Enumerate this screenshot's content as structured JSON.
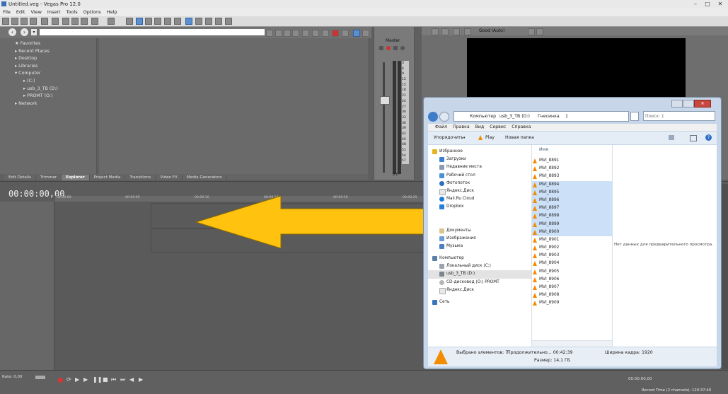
{
  "app": {
    "title": "Untitled.veg - Vegas Pro 12.0",
    "window_controls": [
      "–",
      "□",
      "✕"
    ]
  },
  "menu": [
    "File",
    "Edit",
    "View",
    "Insert",
    "Tools",
    "Options",
    "Help"
  ],
  "explorer_tree": {
    "items": [
      "Favorites",
      "Recent Places",
      "Desktop",
      "Libraries",
      "Computer",
      "(C:)",
      "usb_3_TB (D:)",
      "PROMT (O:)",
      "Network"
    ]
  },
  "tabs": [
    "Edit Details",
    "Trimmer",
    "Explorer",
    "Project Media",
    "Transitions",
    "Video FX",
    "Media Generators"
  ],
  "active_tab": "Explorer",
  "mixer": {
    "label": "Master",
    "scale": [
      "3",
      "6",
      "9",
      "12",
      "15",
      "18",
      "21",
      "24",
      "27",
      "30",
      "33",
      "36",
      "39",
      "42",
      "45",
      "48",
      "51",
      "54",
      "57"
    ],
    "bottom_value": "0.0"
  },
  "preview": {
    "quality": "Good (Auto)"
  },
  "timeline": {
    "timecode": "00:00:00,00",
    "ruler": [
      "00:00:00",
      "00:00:05",
      "00:00:10",
      "00:00:15",
      "00:00:20",
      "00:00:25"
    ],
    "rate": "Rate: 0,00",
    "end_timecode": "00:00:00,00",
    "record_time": "Record Time (2 channels): 120:37:40"
  },
  "win_explorer": {
    "breadcrumb": [
      "Компьютер",
      "usb_3_TB (D:)",
      "Гнесинка",
      "1"
    ],
    "search_placeholder": "Поиск: 1",
    "menu": [
      "Файл",
      "Правка",
      "Вид",
      "Сервис",
      "Справка"
    ],
    "toolbar": {
      "organize": "Упорядочить",
      "play": "Play",
      "new_folder": "Новая папка"
    },
    "column_header": "Имя",
    "nav": [
      "Избранное",
      "Загрузки",
      "Недавние места",
      "Рабочий стол",
      "Фотопоток",
      "Яндекс.Диск",
      "Mail.Ru Cloud",
      "Dropbox",
      "Документы",
      "Изображения",
      "Музыка",
      "Компьютер",
      "Локальный диск (C:)",
      "usb_3_TB (D:)",
      "CD-дисковод (O:) PROMT",
      "Яндекс.Диск",
      "Сеть"
    ],
    "files": [
      {
        "name": "MVI_8891",
        "selected": false
      },
      {
        "name": "MVI_8892",
        "selected": false
      },
      {
        "name": "MVI_8893",
        "selected": false
      },
      {
        "name": "MVI_8894",
        "selected": true
      },
      {
        "name": "MVI_8895",
        "selected": true
      },
      {
        "name": "MVI_8896",
        "selected": true
      },
      {
        "name": "MVI_8897",
        "selected": true
      },
      {
        "name": "MVI_8898",
        "selected": true
      },
      {
        "name": "MVI_8899",
        "selected": true
      },
      {
        "name": "MVI_8900",
        "selected": true
      },
      {
        "name": "MVI_8901",
        "selected": false
      },
      {
        "name": "MVI_8902",
        "selected": false
      },
      {
        "name": "MVI_8903",
        "selected": false
      },
      {
        "name": "MVI_8904",
        "selected": false
      },
      {
        "name": "MVI_8905",
        "selected": false
      },
      {
        "name": "MVI_8906",
        "selected": false
      },
      {
        "name": "MVI_8907",
        "selected": false
      },
      {
        "name": "MVI_8908",
        "selected": false
      },
      {
        "name": "MVI_8909",
        "selected": false
      }
    ],
    "preview_text": "Нет данных для предварительного просмотра.",
    "status": {
      "selected": "Выбрано элементов: 7",
      "duration": "Продолжительно... 00:42:39",
      "frame_width": "Ширина кадра: 1920",
      "size": "Размер: 14,1 ГБ"
    }
  },
  "colors": {
    "arrow": "#ffc20e",
    "selection": "#cce0f7",
    "vlc_orange": "#f28c00"
  }
}
